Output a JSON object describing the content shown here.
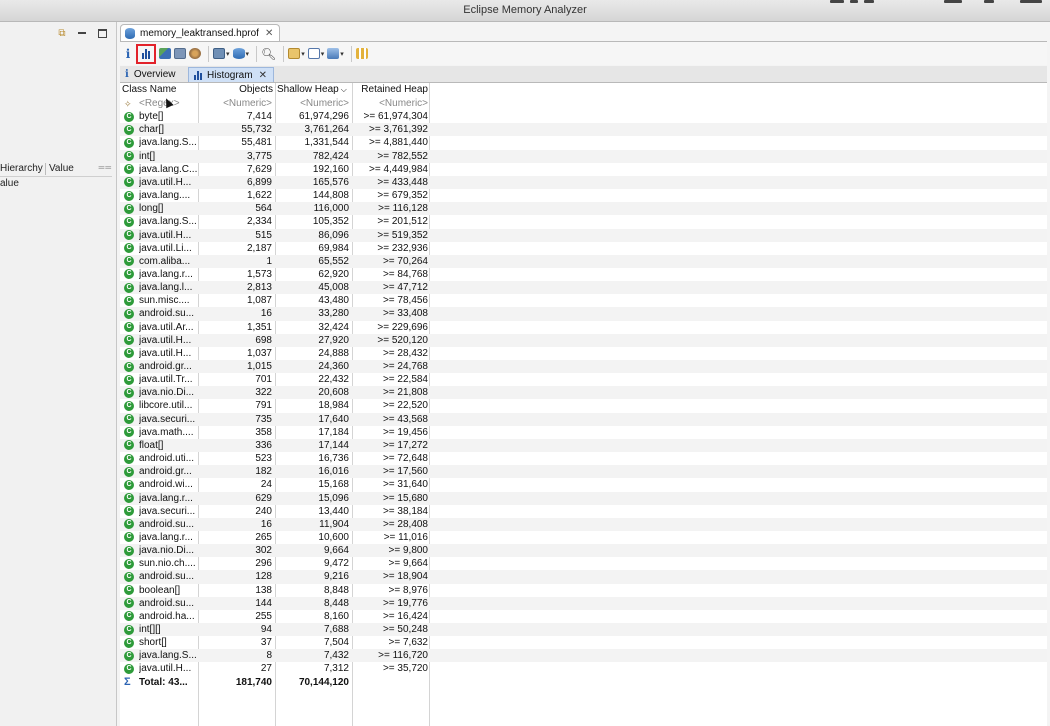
{
  "window": {
    "title": "Eclipse Memory Analyzer"
  },
  "left_panel": {
    "columns": [
      "Hierarchy",
      "Value"
    ],
    "first_row": "alue"
  },
  "editor": {
    "tab_label": "memory_leaktransed.hprof",
    "subtabs": {
      "overview": "Overview",
      "histogram": "Histogram"
    }
  },
  "toolbar": {
    "items": [
      "info-icon",
      "histogram-icon",
      "dominator-tree-icon",
      "top-consumers-icon",
      "duplicate-classes-icon",
      "query-browser-icon",
      "heap-dump-overview-icon",
      "search-icon",
      "group-icon",
      "calculate-icon",
      "export-icon",
      "pin-icon"
    ],
    "highlight_color": "#e2222a"
  },
  "histogram": {
    "columns": {
      "class_name": "Class Name",
      "objects": "Objects",
      "shallow_heap": "Shallow Heap",
      "retained_heap": "Retained Heap"
    },
    "filter_row": {
      "name": "<Regex>",
      "objects": "<Numeric>",
      "shallow": "<Numeric>",
      "retained": "<Numeric>"
    },
    "rows": [
      {
        "name": "byte[]",
        "objects": "7,414",
        "shallow": "61,974,296",
        "retained": ">= 61,974,304"
      },
      {
        "name": "char[]",
        "objects": "55,732",
        "shallow": "3,761,264",
        "retained": ">= 3,761,392"
      },
      {
        "name": "java.lang.S...",
        "objects": "55,481",
        "shallow": "1,331,544",
        "retained": ">= 4,881,440"
      },
      {
        "name": "int[]",
        "objects": "3,775",
        "shallow": "782,424",
        "retained": ">= 782,552"
      },
      {
        "name": "java.lang.C...",
        "objects": "7,629",
        "shallow": "192,160",
        "retained": ">= 4,449,984"
      },
      {
        "name": "java.util.H...",
        "objects": "6,899",
        "shallow": "165,576",
        "retained": ">= 433,448"
      },
      {
        "name": "java.lang....",
        "objects": "1,622",
        "shallow": "144,808",
        "retained": ">= 679,352"
      },
      {
        "name": "long[]",
        "objects": "564",
        "shallow": "116,000",
        "retained": ">= 116,128"
      },
      {
        "name": "java.lang.S...",
        "objects": "2,334",
        "shallow": "105,352",
        "retained": ">= 201,512"
      },
      {
        "name": "java.util.H...",
        "objects": "515",
        "shallow": "86,096",
        "retained": ">= 519,352"
      },
      {
        "name": "java.util.Li...",
        "objects": "2,187",
        "shallow": "69,984",
        "retained": ">= 232,936"
      },
      {
        "name": "com.aliba...",
        "objects": "1",
        "shallow": "65,552",
        "retained": ">= 70,264"
      },
      {
        "name": "java.lang.r...",
        "objects": "1,573",
        "shallow": "62,920",
        "retained": ">= 84,768"
      },
      {
        "name": "java.lang.l...",
        "objects": "2,813",
        "shallow": "45,008",
        "retained": ">= 47,712"
      },
      {
        "name": "sun.misc....",
        "objects": "1,087",
        "shallow": "43,480",
        "retained": ">= 78,456"
      },
      {
        "name": "android.su...",
        "objects": "16",
        "shallow": "33,280",
        "retained": ">= 33,408"
      },
      {
        "name": "java.util.Ar...",
        "objects": "1,351",
        "shallow": "32,424",
        "retained": ">= 229,696"
      },
      {
        "name": "java.util.H...",
        "objects": "698",
        "shallow": "27,920",
        "retained": ">= 520,120"
      },
      {
        "name": "java.util.H...",
        "objects": "1,037",
        "shallow": "24,888",
        "retained": ">= 28,432"
      },
      {
        "name": "android.gr...",
        "objects": "1,015",
        "shallow": "24,360",
        "retained": ">= 24,768"
      },
      {
        "name": "java.util.Tr...",
        "objects": "701",
        "shallow": "22,432",
        "retained": ">= 22,584"
      },
      {
        "name": "java.nio.Di...",
        "objects": "322",
        "shallow": "20,608",
        "retained": ">= 21,808"
      },
      {
        "name": "libcore.util...",
        "objects": "791",
        "shallow": "18,984",
        "retained": ">= 22,520"
      },
      {
        "name": "java.securi...",
        "objects": "735",
        "shallow": "17,640",
        "retained": ">= 43,568"
      },
      {
        "name": "java.math....",
        "objects": "358",
        "shallow": "17,184",
        "retained": ">= 19,456"
      },
      {
        "name": "float[]",
        "objects": "336",
        "shallow": "17,144",
        "retained": ">= 17,272"
      },
      {
        "name": "android.uti...",
        "objects": "523",
        "shallow": "16,736",
        "retained": ">= 72,648"
      },
      {
        "name": "android.gr...",
        "objects": "182",
        "shallow": "16,016",
        "retained": ">= 17,560"
      },
      {
        "name": "android.wi...",
        "objects": "24",
        "shallow": "15,168",
        "retained": ">= 31,640"
      },
      {
        "name": "java.lang.r...",
        "objects": "629",
        "shallow": "15,096",
        "retained": ">= 15,680"
      },
      {
        "name": "java.securi...",
        "objects": "240",
        "shallow": "13,440",
        "retained": ">= 38,184"
      },
      {
        "name": "android.su...",
        "objects": "16",
        "shallow": "11,904",
        "retained": ">= 28,408"
      },
      {
        "name": "java.lang.r...",
        "objects": "265",
        "shallow": "10,600",
        "retained": ">= 11,016"
      },
      {
        "name": "java.nio.Di...",
        "objects": "302",
        "shallow": "9,664",
        "retained": ">= 9,800"
      },
      {
        "name": "sun.nio.ch....",
        "objects": "296",
        "shallow": "9,472",
        "retained": ">= 9,664"
      },
      {
        "name": "android.su...",
        "objects": "128",
        "shallow": "9,216",
        "retained": ">= 18,904"
      },
      {
        "name": "boolean[]",
        "objects": "138",
        "shallow": "8,848",
        "retained": ">= 8,976"
      },
      {
        "name": "android.su...",
        "objects": "144",
        "shallow": "8,448",
        "retained": ">= 19,776"
      },
      {
        "name": "android.ha...",
        "objects": "255",
        "shallow": "8,160",
        "retained": ">= 16,424"
      },
      {
        "name": "int[][]",
        "objects": "94",
        "shallow": "7,688",
        "retained": ">= 50,248"
      },
      {
        "name": "short[]",
        "objects": "37",
        "shallow": "7,504",
        "retained": ">= 7,632"
      },
      {
        "name": "java.lang.S...",
        "objects": "8",
        "shallow": "7,432",
        "retained": ">= 116,720"
      },
      {
        "name": "java.util.H...",
        "objects": "27",
        "shallow": "7,312",
        "retained": ">= 35,720"
      }
    ],
    "total": {
      "name": "Total: 43...",
      "objects": "181,740",
      "shallow": "70,144,120",
      "retained": ""
    }
  }
}
